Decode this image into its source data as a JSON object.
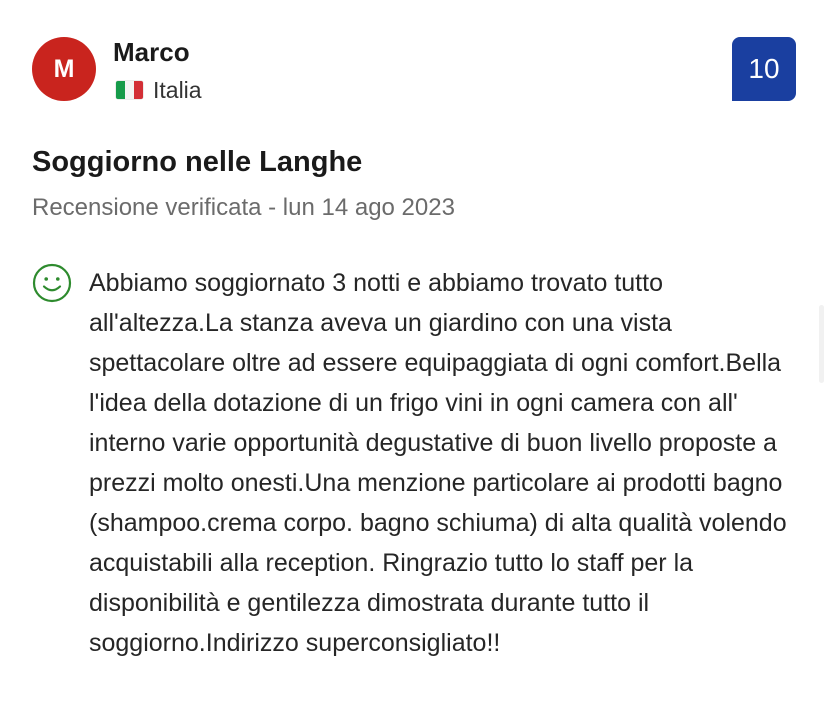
{
  "reviewer": {
    "initial": "M",
    "name": "Marco",
    "country": "Italia",
    "avatar_color": "#c9241e"
  },
  "score": {
    "value": "10",
    "color": "#1a3fa0"
  },
  "review": {
    "title": "Soggiorno nelle Langhe",
    "meta": "Recensione verificata - lun 14 ago 2023",
    "sentiment_icon": "smiley-icon",
    "sentiment_color": "#2e8b2e",
    "body": "Abbiamo soggiornato 3 notti e abbiamo trovato tutto all'altezza.La stanza aveva un giardino con una vista spettacolare oltre ad essere equipaggiata di ogni comfort.Bella l'idea della dotazione di un frigo vini in ogni camera con all' interno varie opportunità degustative di buon livello proposte a prezzi molto onesti.Una menzione particolare ai prodotti bagno (shampoo.crema corpo. bagno schiuma) di alta qualità volendo acquistabili alla reception. Ringrazio tutto lo staff per la disponibilità e gentilezza dimostrata durante tutto il soggiorno.Indirizzo superconsigliato!!"
  }
}
